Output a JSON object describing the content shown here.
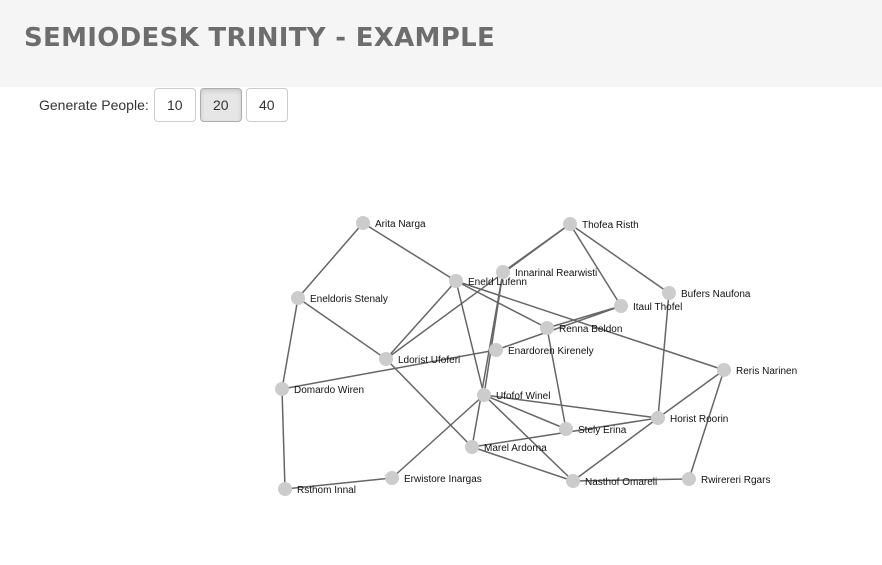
{
  "header": {
    "title": "SEMIODESK TRINITY - EXAMPLE"
  },
  "controls": {
    "label": "Generate People:",
    "buttons": [
      {
        "label": "10",
        "active": false
      },
      {
        "label": "20",
        "active": true
      },
      {
        "label": "40",
        "active": false
      }
    ]
  },
  "graph": {
    "nodes": [
      {
        "name": "Arita Narga"
      },
      {
        "name": "Thofea Risth"
      },
      {
        "name": "Innarinal Rearwisti"
      },
      {
        "name": "Eneld Lufenn"
      },
      {
        "name": "Bufers Naufona"
      },
      {
        "name": "Eneldoris Stenaly"
      },
      {
        "name": "Itaul Thofel"
      },
      {
        "name": "Renna Beldon"
      },
      {
        "name": "Enardoren Kirenely"
      },
      {
        "name": "Ldorist Ufoferi"
      },
      {
        "name": "Reris Narinen"
      },
      {
        "name": "Domardo Wiren"
      },
      {
        "name": "Ufofof Winel"
      },
      {
        "name": "Horist Roorin"
      },
      {
        "name": "Stely Erina"
      },
      {
        "name": "Marel Ardorna"
      },
      {
        "name": "Erwistore Inargas"
      },
      {
        "name": "Rsthom Innal"
      },
      {
        "name": "Nasthof Omareli"
      },
      {
        "name": "Rwirereri Rgars"
      }
    ],
    "links": [
      [
        "Arita Narga",
        "Eneldoris Stenaly"
      ],
      [
        "Arita Narga",
        "Eneld Lufenn"
      ],
      [
        "Eneldoris Stenaly",
        "Domardo Wiren"
      ],
      [
        "Eneldoris Stenaly",
        "Ldorist Ufoferi"
      ],
      [
        "Domardo Wiren",
        "Rsthom Innal"
      ],
      [
        "Domardo Wiren",
        "Enardoren Kirenely"
      ],
      [
        "Rsthom Innal",
        "Erwistore Inargas"
      ],
      [
        "Erwistore Inargas",
        "Ufofof Winel"
      ],
      [
        "Ldorist Ufoferi",
        "Eneld Lufenn"
      ],
      [
        "Ldorist Ufoferi",
        "Marel Ardorna"
      ],
      [
        "Ldorist Ufoferi",
        "Thofea Risth"
      ],
      [
        "Eneld Lufenn",
        "Ufofof Winel"
      ],
      [
        "Eneld Lufenn",
        "Renna Beldon"
      ],
      [
        "Thofea Risth",
        "Innarinal Rearwisti"
      ],
      [
        "Thofea Risth",
        "Itaul Thofel"
      ],
      [
        "Thofea Risth",
        "Bufers Naufona"
      ],
      [
        "Innarinal Rearwisti",
        "Ufofof Winel"
      ],
      [
        "Innarinal Rearwisti",
        "Marel Ardorna"
      ],
      [
        "Bufers Naufona",
        "Horist Roorin"
      ],
      [
        "Itaul Thofel",
        "Renna Beldon"
      ],
      [
        "Itaul Thofel",
        "Enardoren Kirenely"
      ],
      [
        "Eneld Lufenn",
        "Reris Narinen"
      ],
      [
        "Renna Beldon",
        "Stely Erina"
      ],
      [
        "Ufofof Winel",
        "Stely Erina"
      ],
      [
        "Ufofof Winel",
        "Nasthof Omareli"
      ],
      [
        "Ufofof Winel",
        "Horist Roorin"
      ],
      [
        "Reris Narinen",
        "Horist Roorin"
      ],
      [
        "Reris Narinen",
        "Rwirereri Rgars"
      ],
      [
        "Horist Roorin",
        "Nasthof Omareli"
      ],
      [
        "Horist Roorin",
        "Marel Ardorna"
      ],
      [
        "Marel Ardorna",
        "Nasthof Omareli"
      ],
      [
        "Nasthof Omareli",
        "Rwirereri Rgars"
      ]
    ]
  }
}
